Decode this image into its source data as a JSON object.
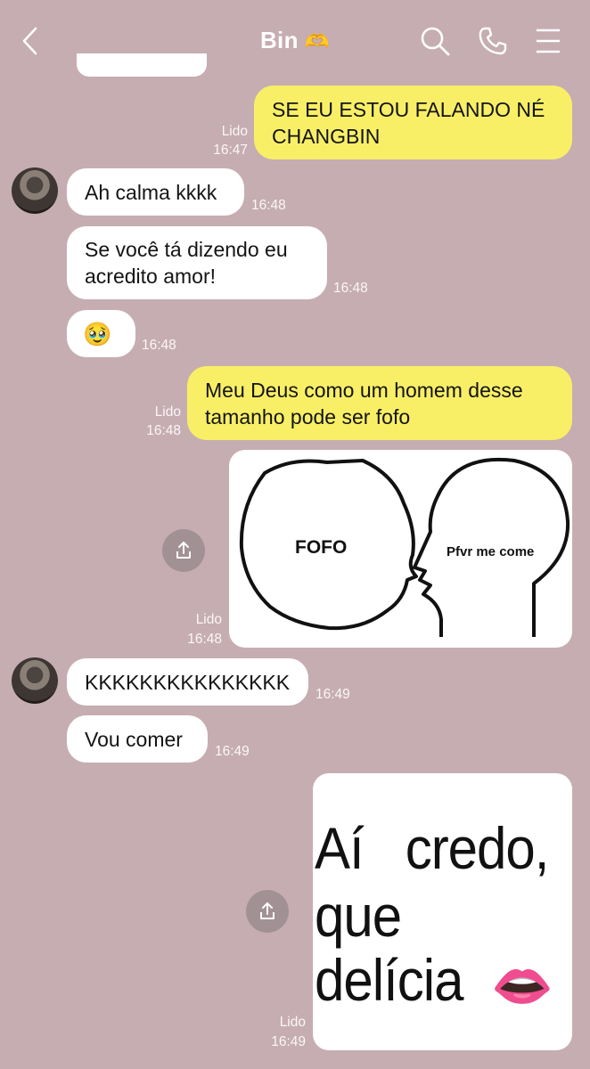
{
  "header": {
    "contact_name": "Bin",
    "contact_emoji": "🫶"
  },
  "messages": {
    "m1": {
      "text": "SE EU ESTOU FALANDO NÉ\nCHANGBIN",
      "status": "Lido",
      "time": "16:47"
    },
    "m2": {
      "text": "Ah calma kkkk",
      "time": "16:48"
    },
    "m3": {
      "text": "Se você tá dizendo eu\nacredito amor!",
      "time": "16:48"
    },
    "m4": {
      "text": "🥹",
      "time": "16:48"
    },
    "m5": {
      "text": "Meu Deus como um homem desse\ntamanho pode ser fofo",
      "status": "Lido",
      "time": "16:48"
    },
    "m6": {
      "status": "Lido",
      "time": "16:48",
      "meme_left": "FOFO",
      "meme_right": "Pfvr me come"
    },
    "m7": {
      "text": "KKKKKKKKKKKKKKK",
      "time": "16:49"
    },
    "m8": {
      "text": "Vou comer",
      "time": "16:49"
    },
    "m9": {
      "status": "Lido",
      "time": "16:49",
      "sticker_line1": "Aí   credo,",
      "sticker_line2": "que",
      "sticker_line3": "delícia",
      "sticker_emoji": "👄"
    }
  },
  "colors": {
    "background": "#c6adb2",
    "outgoing": "#f8ef67",
    "incoming": "#ffffff"
  }
}
